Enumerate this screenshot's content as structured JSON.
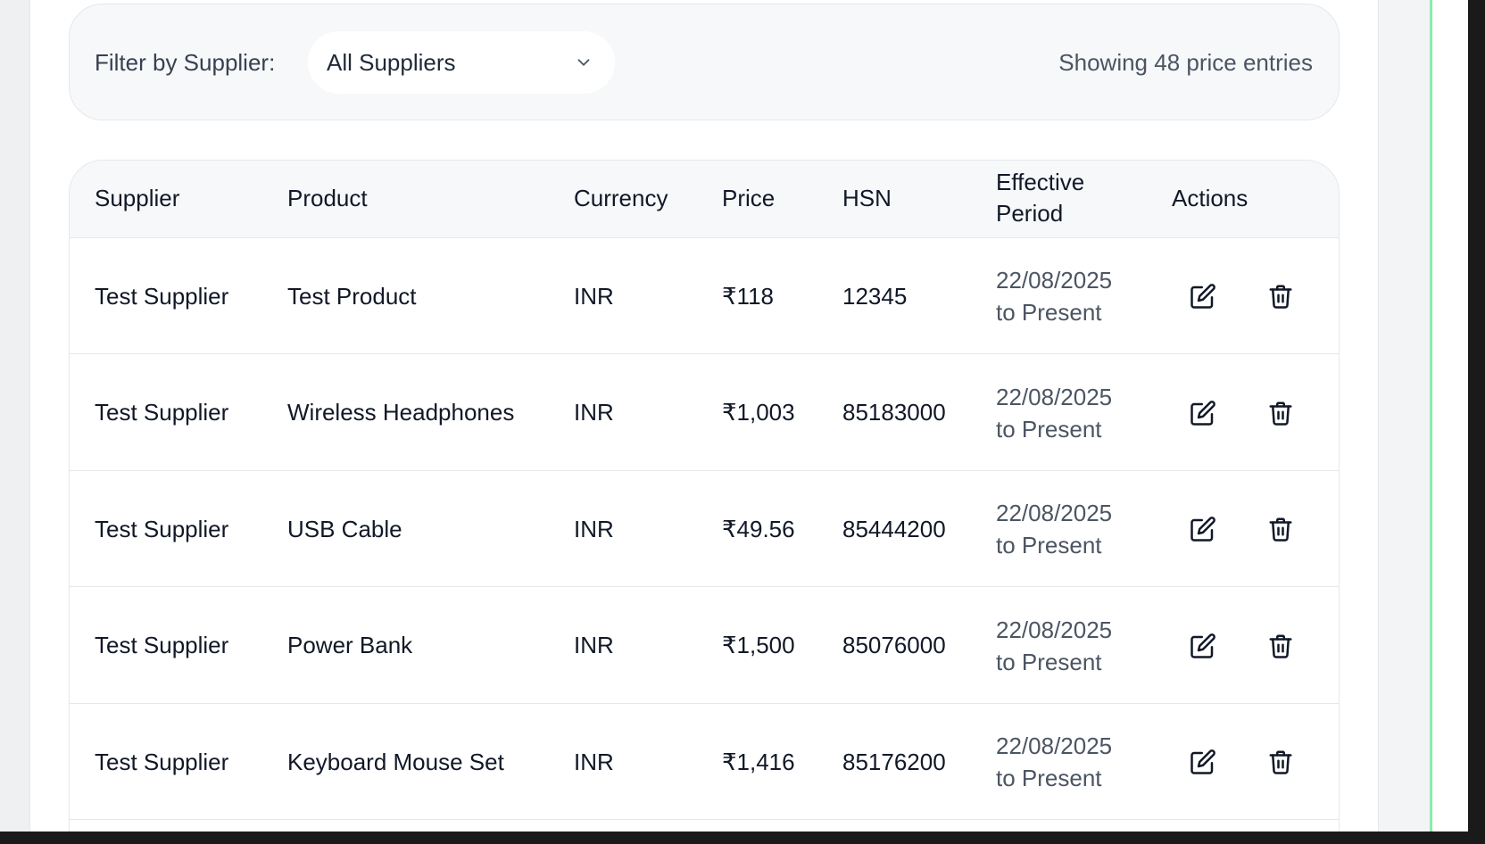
{
  "filter": {
    "label": "Filter by Supplier:",
    "selected_supplier": "All Suppliers",
    "showing_text": "Showing 48 price entries"
  },
  "table": {
    "columns": {
      "supplier": "Supplier",
      "product": "Product",
      "currency": "Currency",
      "price": "Price",
      "hsn": "HSN",
      "period_line1": "Effective",
      "period_line2": "Period",
      "actions": "Actions"
    },
    "rows": [
      {
        "supplier": "Test Supplier",
        "product": "Test Product",
        "currency": "INR",
        "price": "₹118",
        "hsn": "12345",
        "period_start": "22/08/2025",
        "period_end": "to Present"
      },
      {
        "supplier": "Test Supplier",
        "product": "Wireless Headphones",
        "currency": "INR",
        "price": "₹1,003",
        "hsn": "85183000",
        "period_start": "22/08/2025",
        "period_end": "to Present"
      },
      {
        "supplier": "Test Supplier",
        "product": "USB Cable",
        "currency": "INR",
        "price": "₹49.56",
        "hsn": "85444200",
        "period_start": "22/08/2025",
        "period_end": "to Present"
      },
      {
        "supplier": "Test Supplier",
        "product": "Power Bank",
        "currency": "INR",
        "price": "₹1,500",
        "hsn": "85076000",
        "period_start": "22/08/2025",
        "period_end": "to Present"
      },
      {
        "supplier": "Test Supplier",
        "product": "Keyboard Mouse Set",
        "currency": "INR",
        "price": "₹1,416",
        "hsn": "85176200",
        "period_start": "22/08/2025",
        "period_end": "to Present"
      }
    ]
  },
  "icons": {
    "select": "chevron-down-icon",
    "edit": "edit-icon",
    "delete": "trash-icon"
  },
  "colors": {
    "accent_line": "#86efac",
    "header_bg": "#f7f8fa",
    "border": "#e5e7eb"
  }
}
